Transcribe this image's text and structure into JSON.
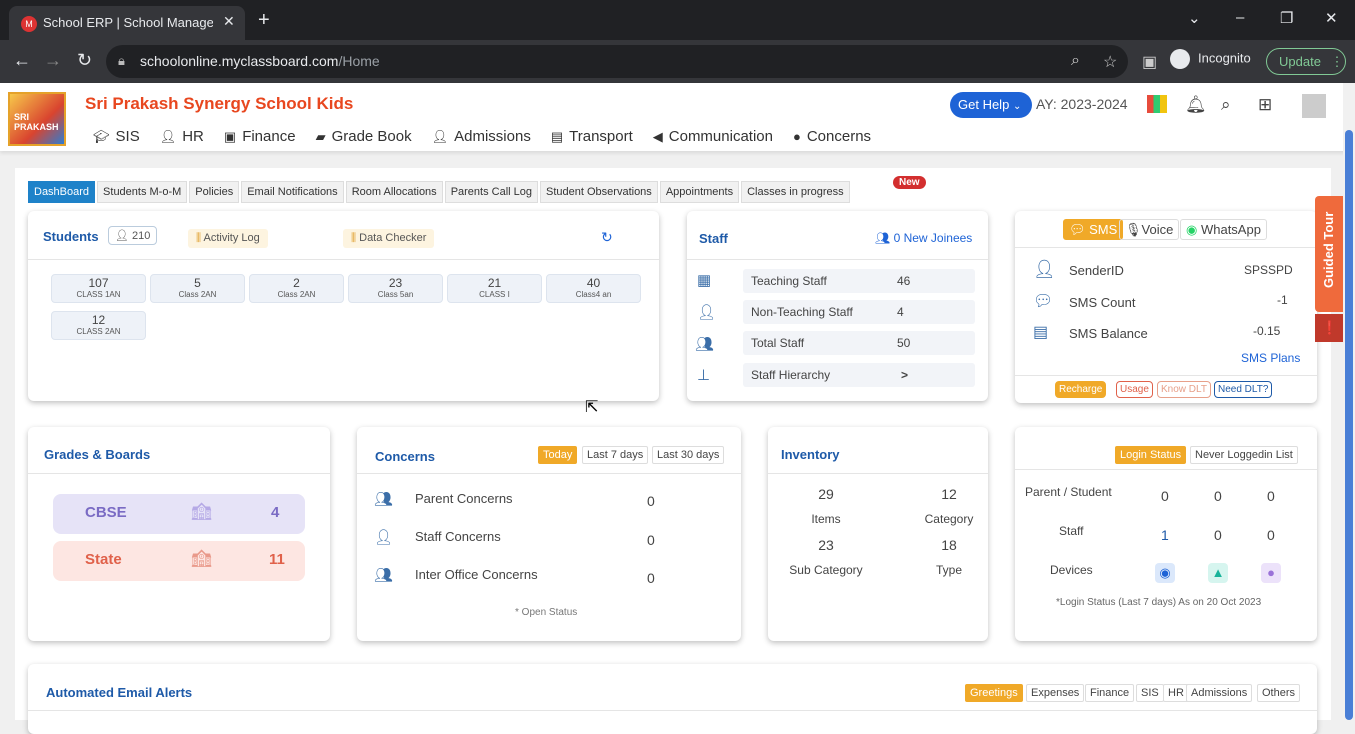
{
  "browser": {
    "tab_title": "School ERP | School Managemen",
    "url_host": "schoolonline.myclassboard.com",
    "url_path": "/Home",
    "incognito_label": "Incognito",
    "update_label": "Update"
  },
  "header": {
    "school_name": "Sri Prakash Synergy School Kids",
    "logo_text": "SRI PRAKASH",
    "get_help": "Get Help",
    "academic_year": "AY: 2023-2024",
    "nav": [
      {
        "label": "SIS",
        "icon": "graduation-cap-icon"
      },
      {
        "label": "HR",
        "icon": "user-icon"
      },
      {
        "label": "Finance",
        "icon": "money-icon"
      },
      {
        "label": "Grade Book",
        "icon": "book-icon"
      },
      {
        "label": "Admissions",
        "icon": "user-icon"
      },
      {
        "label": "Transport",
        "icon": "bus-icon"
      },
      {
        "label": "Communication",
        "icon": "megaphone-icon"
      },
      {
        "label": "Concerns",
        "icon": "users-icon"
      }
    ]
  },
  "subtabs": [
    "DashBoard",
    "Students M-o-M",
    "Policies",
    "Email Notifications",
    "Room Allocations",
    "Parents Call Log",
    "Student Observations",
    "Appointments",
    "Classes in progress"
  ],
  "new_badge": "New",
  "students": {
    "title": "Students",
    "count": "210",
    "activity_log": "Activity Log",
    "data_checker": "Data Checker",
    "classes": [
      {
        "count": "107",
        "name": "CLASS 1AN"
      },
      {
        "count": "5",
        "name": "Class 2AN"
      },
      {
        "count": "2",
        "name": "Class 2AN"
      },
      {
        "count": "23",
        "name": "Class 5an"
      },
      {
        "count": "21",
        "name": "CLASS I"
      },
      {
        "count": "40",
        "name": "Class4 an"
      },
      {
        "count": "12",
        "name": "CLASS 2AN"
      }
    ]
  },
  "staff": {
    "title": "Staff",
    "new_joinees": "0 New Joinees",
    "rows": [
      {
        "label": "Teaching Staff",
        "value": "46"
      },
      {
        "label": "Non-Teaching Staff",
        "value": "4"
      },
      {
        "label": "Total Staff",
        "value": "50"
      },
      {
        "label": "Staff Hierarchy",
        "value": ">"
      }
    ]
  },
  "sms": {
    "channels": [
      "SMS",
      "Voice",
      "WhatsApp"
    ],
    "sender_id_label": "SenderID",
    "sender_id": "SPSSPD",
    "count_label": "SMS Count",
    "count": "-1",
    "balance_label": "SMS Balance",
    "balance": "-0.15",
    "plans": "SMS Plans",
    "buttons": [
      "Recharge",
      "Usage",
      "Know DLT",
      "Need DLT?"
    ]
  },
  "grades": {
    "title": "Grades & Boards",
    "boards": [
      {
        "name": "CBSE",
        "count": "4",
        "bg": "#e6e3f7",
        "fg": "#7a6bc4"
      },
      {
        "name": "State",
        "count": "11",
        "bg": "#fde6e2",
        "fg": "#e0614a"
      }
    ]
  },
  "concerns": {
    "title": "Concerns",
    "ranges": [
      "Today",
      "Last 7 days",
      "Last 30 days"
    ],
    "rows": [
      {
        "label": "Parent Concerns",
        "value": "0"
      },
      {
        "label": "Staff Concerns",
        "value": "0"
      },
      {
        "label": "Inter Office Concerns",
        "value": "0"
      }
    ],
    "note": "* Open Status"
  },
  "inventory": {
    "title": "Inventory",
    "items": "29",
    "items_label": "Items",
    "category": "12",
    "category_label": "Category",
    "sub_category": "23",
    "sub_category_label": "Sub Category",
    "type": "18",
    "type_label": "Type"
  },
  "login": {
    "tabs": [
      "Login Status",
      "Never Loggedin List"
    ],
    "rows": [
      {
        "label": "Parent / Student",
        "v1": "0",
        "v2": "0",
        "v3": "0"
      },
      {
        "label": "Staff",
        "v1": "1",
        "v2": "0",
        "v3": "0"
      }
    ],
    "devices_label": "Devices",
    "note": "*Login Status (Last 7 days) As on 20 Oct 2023"
  },
  "email": {
    "title": "Automated Email Alerts",
    "tabs": [
      "Greetings",
      "Expenses",
      "Finance",
      "SIS",
      "HR",
      "Admissions",
      "Others"
    ]
  },
  "guided_tour": "Guided Tour",
  "colors": {
    "accent": "#1e5aa8",
    "orange": "#f0a928",
    "brand_red": "#e8471f"
  }
}
